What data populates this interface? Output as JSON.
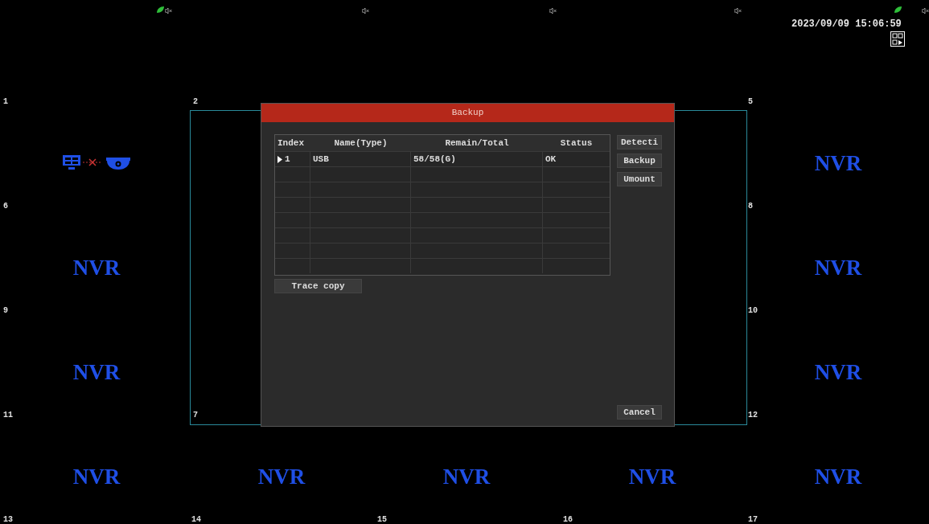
{
  "status": {
    "datetime": "2023/09/09 15:06:59"
  },
  "channel_labels": [
    "1",
    "2",
    "5",
    "6",
    "8",
    "9",
    "10",
    "11",
    "7",
    "12",
    "13",
    "14",
    "15",
    "16",
    "17"
  ],
  "nvr_logos": [
    "NVR",
    "NVR",
    "NVR",
    "NVR",
    "NVR",
    "NVR",
    "NVR",
    "NVR",
    "NVR",
    "NVR"
  ],
  "dialog": {
    "title": "Backup",
    "table": {
      "columns": [
        "Index",
        "Name(Type)",
        "Remain/Total",
        "Status"
      ],
      "rows": [
        {
          "selected": true,
          "cells": [
            "1",
            "USB",
            "58/58(G)",
            "OK"
          ]
        }
      ]
    },
    "side_buttons": [
      "Detecti",
      "Backup",
      "Umount"
    ],
    "trace_copy_button": "Trace copy",
    "cancel_button": "Cancel"
  }
}
